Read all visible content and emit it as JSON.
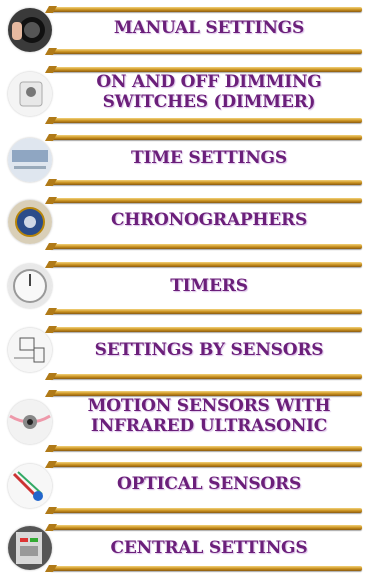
{
  "items": [
    {
      "label": "MANUAL SETTINGS",
      "icon": "dial-icon"
    },
    {
      "label": "ON AND OFF DIMMING SWITCHES (DIMMER)",
      "icon": "dimmer-switch-icon"
    },
    {
      "label": "TIME SETTINGS",
      "icon": "time-panel-icon"
    },
    {
      "label": "CHRONOGRAPHERS",
      "icon": "chronograph-icon"
    },
    {
      "label": "TIMERS",
      "icon": "timer-icon"
    },
    {
      "label": "SETTINGS BY SENSORS",
      "icon": "sensor-diagram-icon"
    },
    {
      "label": "MOTION SENSORS WITH INFRARED ULTRASONIC",
      "icon": "motion-sensor-icon"
    },
    {
      "label": "OPTICAL SENSORS",
      "icon": "optical-sensor-icon"
    },
    {
      "label": "CENTRAL SETTINGS",
      "icon": "central-panel-icon"
    }
  ]
}
